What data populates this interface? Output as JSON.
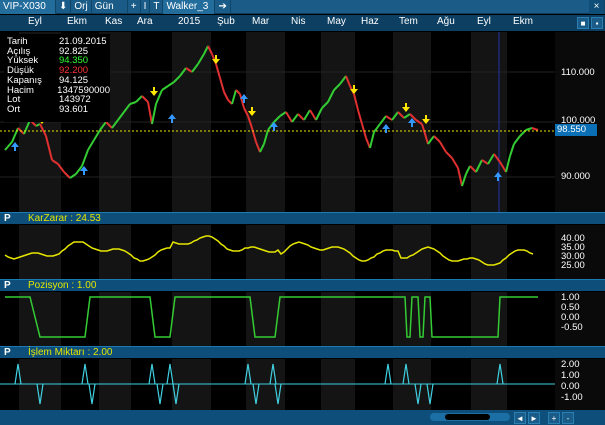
{
  "toolbar": {
    "symbol": "VIP-X030",
    "down_arrow": "⬇",
    "orj": "Orj",
    "period": "Gün",
    "plus": "+",
    "cursor": "I",
    "tab_arrow": "T",
    "strategy": "Walker_3",
    "right_arrow": "➔"
  },
  "months": [
    "Eyl",
    "Ekm",
    "Kas",
    "Ara",
    "2015",
    "Şub",
    "Mar",
    "Nis",
    "May",
    "Haz",
    "Tem",
    "Ağu",
    "Eyl",
    "Ekm"
  ],
  "info_box": [
    {
      "k": "Tarih",
      "v": "21.09.2015",
      "color": "#ffffff"
    },
    {
      "k": "Açılış",
      "v": "92.825",
      "color": "#ffffff"
    },
    {
      "k": "Yüksek",
      "v": "94.350",
      "color": "#33ff33"
    },
    {
      "k": "Düşük",
      "v": "92.200",
      "color": "#ff3333"
    },
    {
      "k": "Kapanış",
      "v": "94.125",
      "color": "#ffffff"
    },
    {
      "k": "Hacim",
      "v": "1347590000",
      "color": "#ffffff"
    },
    {
      "k": "Lot",
      "v": "143972",
      "color": "#ffffff"
    },
    {
      "k": "Ort",
      "v": "93.601",
      "color": "#ffffff"
    }
  ],
  "price_axis": [
    "110.000",
    "100.000",
    "90.000"
  ],
  "last_price": "98.550",
  "panels": {
    "karzarar": {
      "p": "P",
      "title": "KarZarar : 24.53",
      "axis": [
        "40.00",
        "35.00",
        "30.00",
        "25.00"
      ]
    },
    "pozisyon": {
      "p": "P",
      "title": "Pozisyon : 1.00",
      "axis": [
        "1.00",
        "0.50",
        "0.00",
        "-0.50"
      ]
    },
    "islem": {
      "p": "P",
      "title": "İşlem Miktarı : 2.00",
      "axis": [
        "2.00",
        "1.00",
        "0.00",
        "-1.00"
      ]
    }
  },
  "colors": {
    "up": "#33cc33",
    "down": "#e03030",
    "accent": "#0d4f7a",
    "yellow": "#ffff00",
    "cyan": "#40d0e0"
  }
}
